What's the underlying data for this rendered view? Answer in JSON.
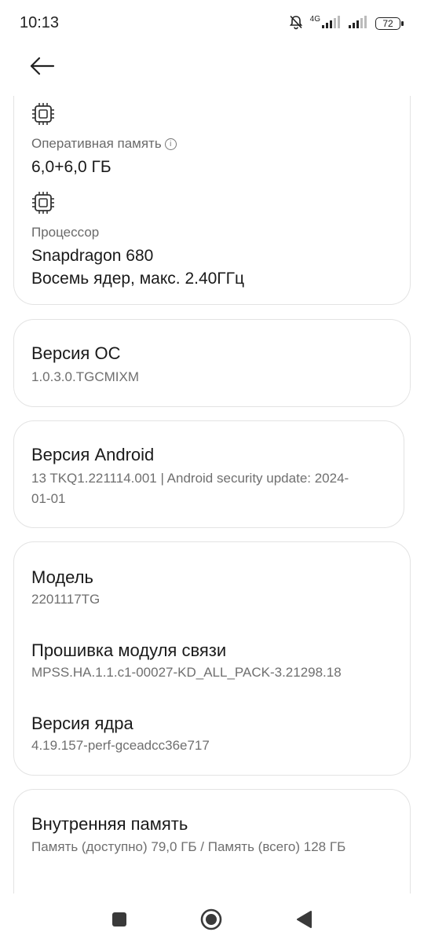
{
  "status_bar": {
    "time": "10:13",
    "network": "4G",
    "battery": "72",
    "icons": [
      "bell-off-icon",
      "signal-4g-icon",
      "signal-icon",
      "battery-icon"
    ]
  },
  "header": {
    "back_icon": "arrow-left-icon"
  },
  "hardware_card": {
    "ram": {
      "icon": "chip-icon",
      "label": "Оперативная память",
      "info_icon": "info-icon",
      "value": "6,0+6,0 ГБ"
    },
    "cpu": {
      "icon": "chip-icon",
      "label": "Процессор",
      "value_line1": "Snapdragon 680",
      "value_line2": "Восемь ядер, макс. 2.40ГГц"
    }
  },
  "os_card": {
    "title": "Версия ОС",
    "value": "1.0.3.0.TGCMIXM"
  },
  "android_card": {
    "title": "Версия Android",
    "value": "13 TKQ1.221114.001 | Android security update: 2024-01-01"
  },
  "device_card": {
    "model": {
      "title": "Модель",
      "value": "2201117TG"
    },
    "baseband": {
      "title": "Прошивка модуля связи",
      "value": "MPSS.HA.1.1.c1-00027-KD_ALL_PACK-3.21298.18"
    },
    "kernel": {
      "title": "Версия ядра",
      "value": "4.19.157-perf-gceadcc36e717"
    }
  },
  "storage_card": {
    "title": "Внутренняя память",
    "value": "Память (доступно)  79,0 ГБ / Память (всего)  128 ГБ"
  },
  "nav_bar": {
    "icons": [
      "recents-square-icon",
      "home-circle-icon",
      "back-triangle-icon"
    ]
  }
}
